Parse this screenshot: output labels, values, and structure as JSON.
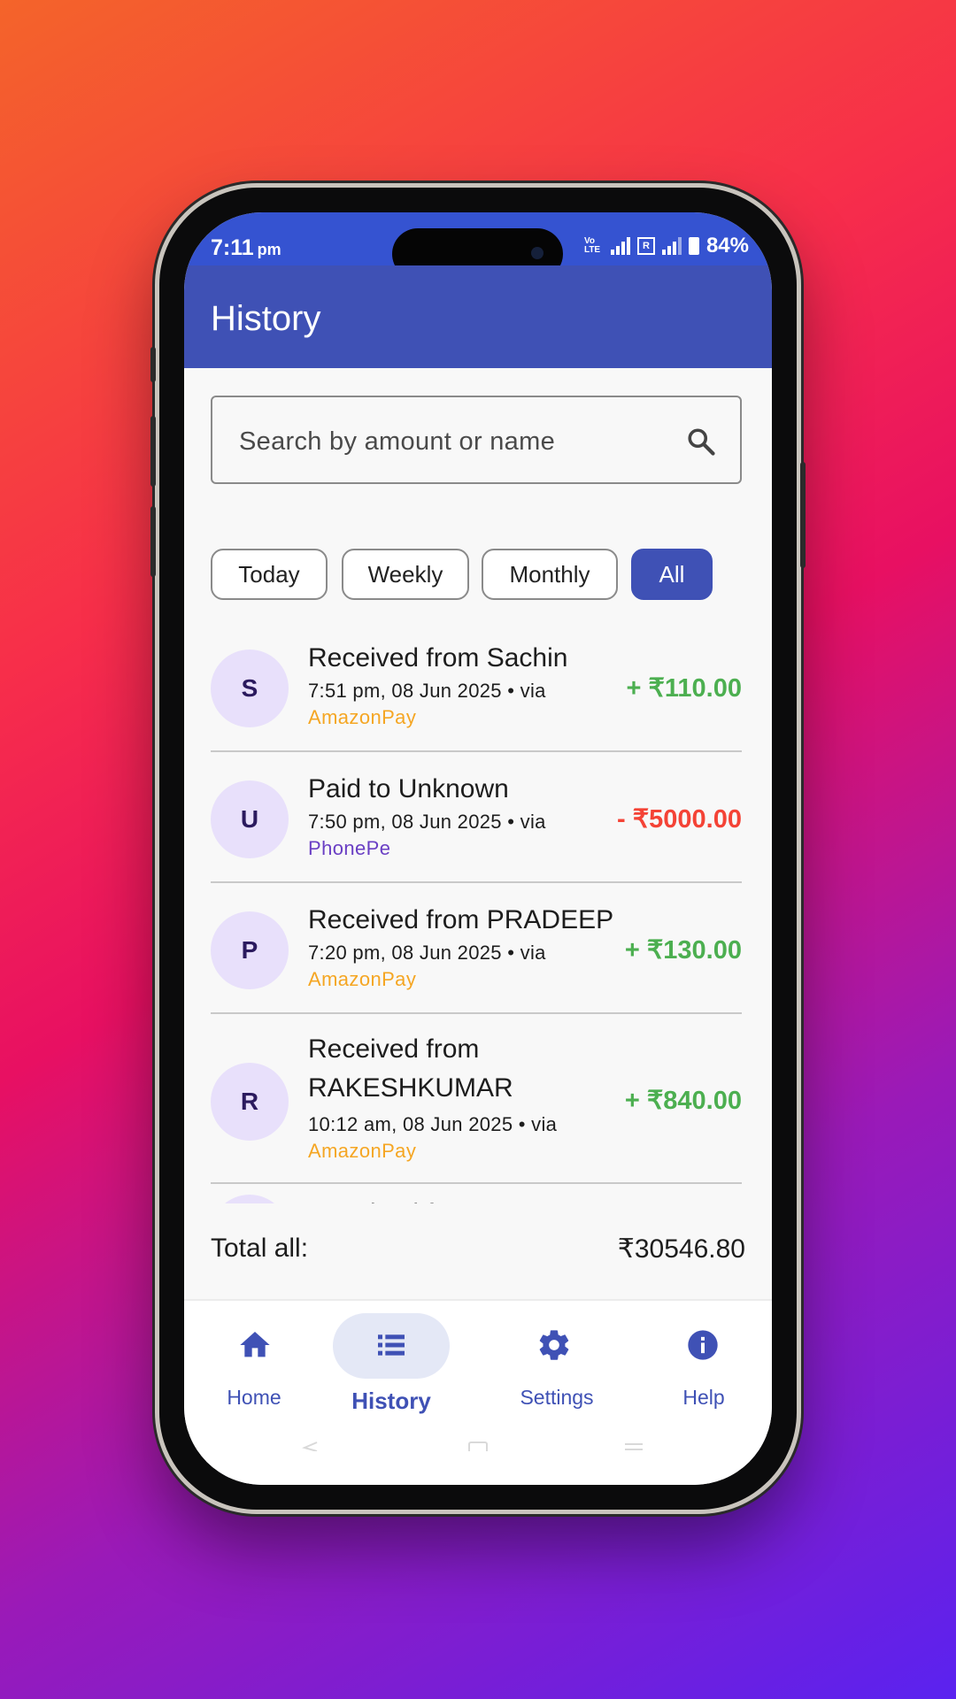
{
  "status_bar": {
    "time": "7:11",
    "ampm": "pm",
    "volte": "Vo LTE",
    "sim_badge": "R",
    "battery": "84%"
  },
  "app_bar": {
    "title": "History"
  },
  "search": {
    "placeholder": "Search by amount or name",
    "icon": "search-icon"
  },
  "filters": [
    {
      "label": "Today",
      "active": false
    },
    {
      "label": "Weekly",
      "active": false
    },
    {
      "label": "Monthly",
      "active": false
    },
    {
      "label": "All",
      "active": true
    }
  ],
  "transactions": [
    {
      "initial": "S",
      "title": "Received from Sachin",
      "meta": "7:51 pm, 08 Jun 2025 • via",
      "app": "AmazonPay",
      "app_color": "#f5a623",
      "amount": "+ ₹110.00",
      "type": "credit"
    },
    {
      "initial": "U",
      "title": "Paid to Unknown",
      "meta": "7:50 pm, 08 Jun 2025 • via",
      "app": "PhonePe",
      "app_color": "#6a3fc4",
      "amount": "- ₹5000.00",
      "type": "debit"
    },
    {
      "initial": "P",
      "title": "Received from PRADEEP",
      "meta": "7:20 pm, 08 Jun 2025 • via",
      "app": "AmazonPay",
      "app_color": "#f5a623",
      "amount": "+ ₹130.00",
      "type": "credit"
    },
    {
      "initial": "R",
      "title": "Received from RAKESHKUMAR",
      "meta": "10:12 am, 08 Jun 2025 • via",
      "app": "AmazonPay",
      "app_color": "#f5a623",
      "amount": "+ ₹840.00",
      "type": "credit"
    },
    {
      "initial": "K",
      "title": "Received from KAUSHIK",
      "partial": true
    }
  ],
  "total": {
    "label": "Total all:",
    "value": "₹30546.80"
  },
  "bottom_nav": [
    {
      "label": "Home",
      "icon": "home-icon",
      "active": false
    },
    {
      "label": "History",
      "icon": "list-icon",
      "active": true
    },
    {
      "label": "Settings",
      "icon": "gear-icon",
      "active": false
    },
    {
      "label": "Help",
      "icon": "info-icon",
      "active": false
    }
  ],
  "colors": {
    "primary": "#3f51b5",
    "status_bar": "#3553d1",
    "credit": "#4caf50",
    "debit": "#f44336",
    "avatar_bg": "#e8e0fb"
  }
}
